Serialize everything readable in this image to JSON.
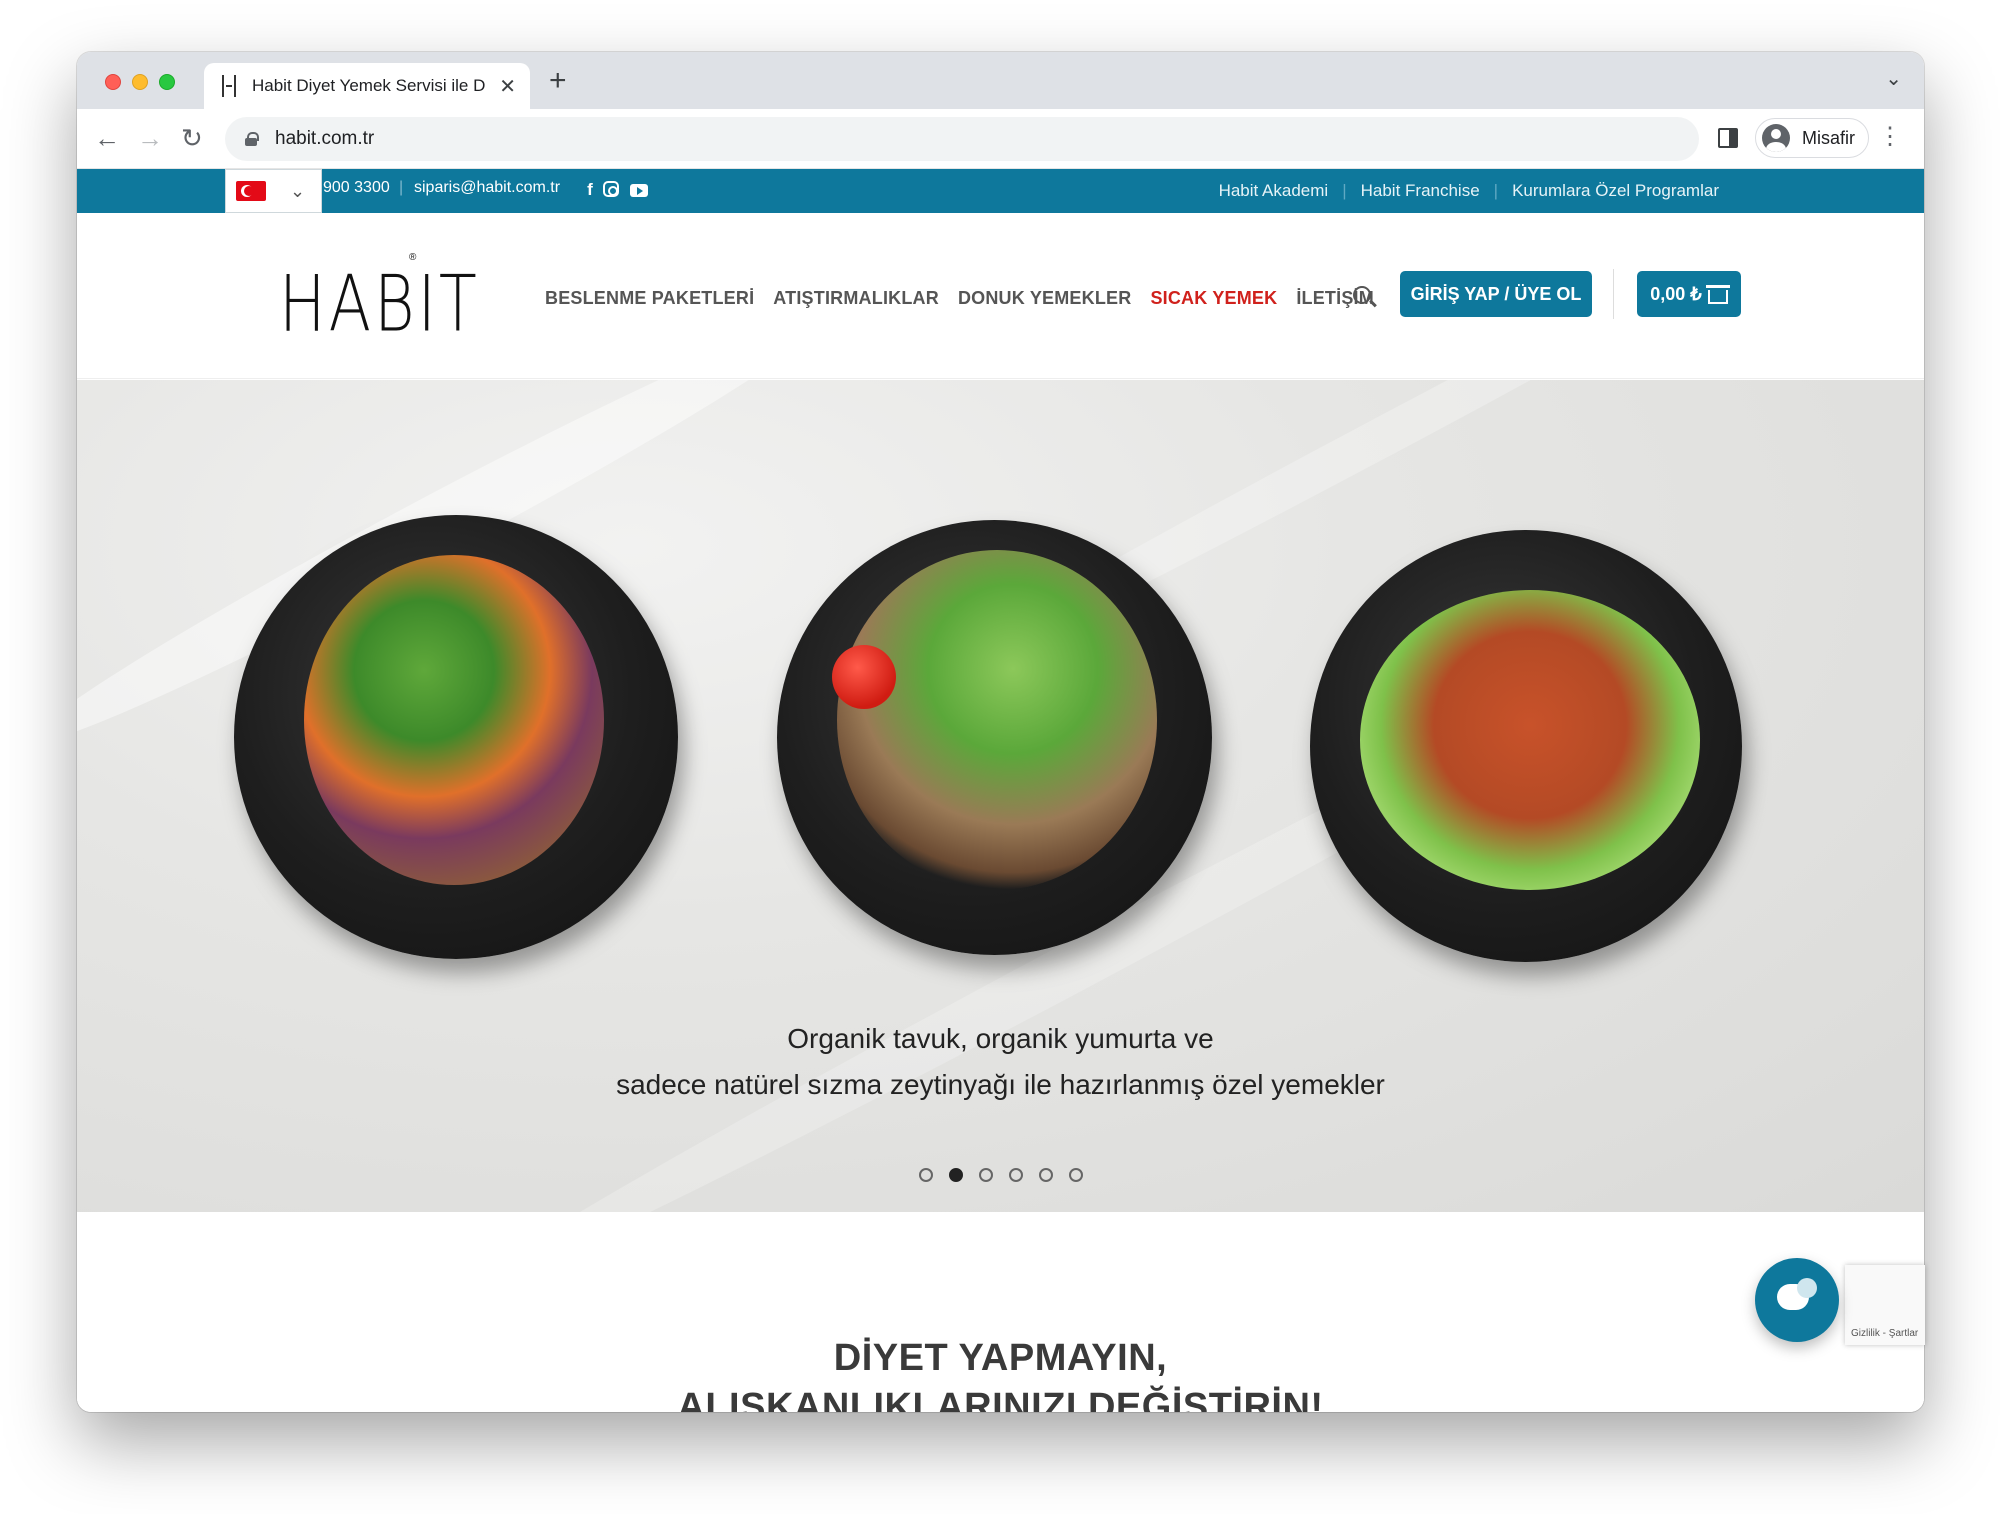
{
  "browser": {
    "tab_title": "Habit Diyet Yemek Servisi ile D",
    "url": "habit.com.tr",
    "profile_name": "Misafir"
  },
  "topbar": {
    "phone": "900 3300",
    "separator": "|",
    "email": "siparis@habit.com.tr",
    "links": [
      "Habit Akademi",
      "Habit Franchise",
      "Kurumlara Özel Programlar"
    ]
  },
  "header": {
    "logo": "HABIT",
    "nav": [
      "BESLENME PAKETLERİ",
      "ATIŞTIRMALIKLAR",
      "DONUK YEMEKLER",
      "SICAK YEMEK",
      "İLETİŞİM"
    ],
    "login_label": "GİRİŞ YAP / ÜYE OL",
    "cart_total": "0,00 ₺"
  },
  "hero": {
    "caption_line1": "Organik tavuk, organik yumurta ve",
    "caption_line2": "sadece natürel sızma zeytinyağı ile hazırlanmış özel yemekler",
    "slide_count": 6,
    "active_slide": 2
  },
  "section": {
    "title_line1": "DİYET YAPMAYIN,",
    "title_line2": "ALIŞKANLIKLARINIZI DEĞİŞTİRİN!"
  },
  "recaptcha": {
    "label": "Gizlilik - Şartlar"
  },
  "colors": {
    "brand": "#0e789c",
    "accent_nav": "#d0211c"
  }
}
